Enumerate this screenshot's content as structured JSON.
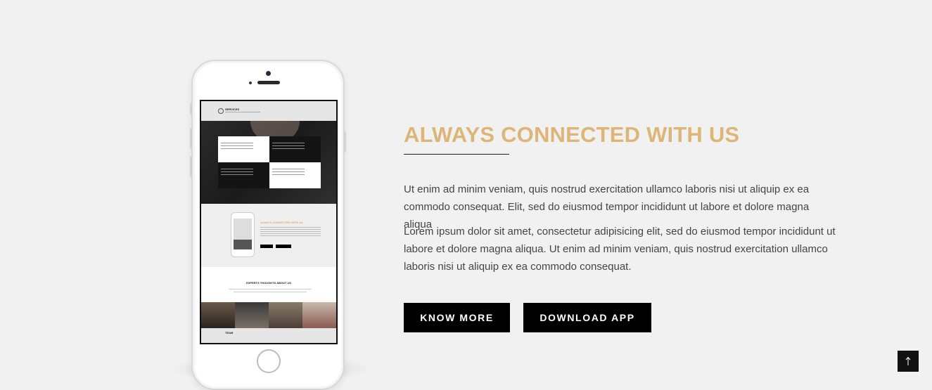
{
  "section": {
    "headline": "ALWAYS CONNECTED WITH US",
    "paragraphs": [
      "Ut enim ad minim veniam, quis nostrud exercitation ullamco laboris nisi ut aliquip ex ea commodo consequat. Elit, sed do eiusmod tempor incididunt ut labore et dolore magna aliqua",
      "Lorem ipsum dolor sit amet, consectetur adipisicing elit, sed do eiusmod tempor incididunt ut labore et dolore magna aliqua. Ut enim ad minim veniam, quis nostrud exercitation ullamco laboris nisi ut aliquip ex ea commodo consequat."
    ],
    "buttons": {
      "know_more": "KNOW MORE",
      "download_app": "DOWNLOAD APP"
    }
  },
  "phone_mockup": {
    "screen_sections": {
      "services_title": "SERVICES",
      "connected_title": "ALWAYS CONNECTED WITH US",
      "experts_title": "EXPERTS THOUGHTS ABOUT US",
      "team_title": "TEAM"
    }
  },
  "scroll_top": {
    "icon": "arrow-up-icon"
  },
  "colors": {
    "accent": "#ddb677",
    "background": "#f1f1f1",
    "button": "#000000",
    "text": "#444444"
  }
}
